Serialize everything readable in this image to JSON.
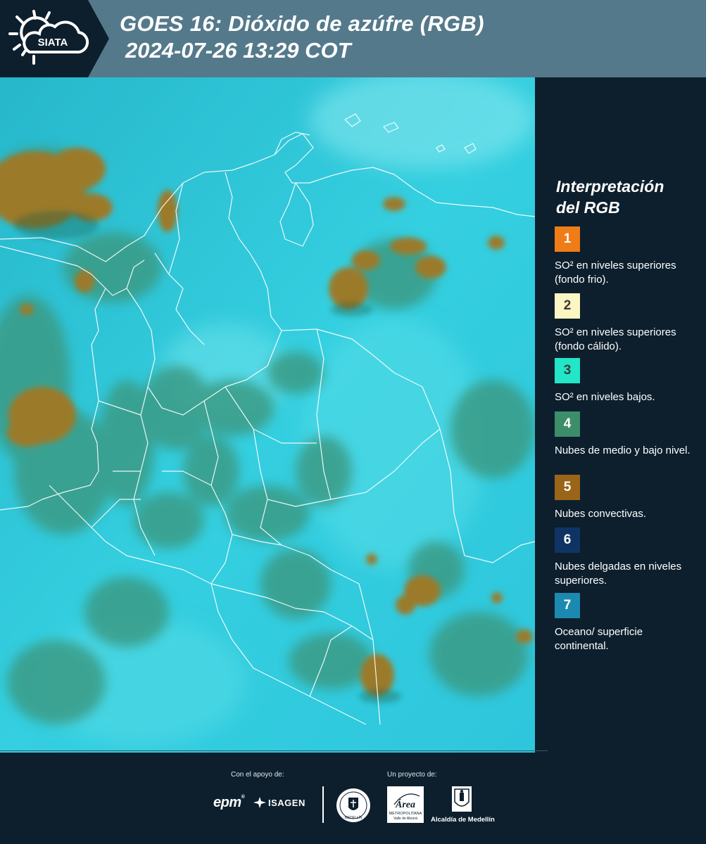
{
  "header": {
    "logo_text": "SIATA",
    "title_line1": "GOES 16: Dióxido de azúfre (RGB)",
    "title_line2": "2024-07-26 13:29 COT"
  },
  "map": {
    "name": "satellite-rgb-map",
    "colors": {
      "ocean": "#33d2e4",
      "land": "#2bbacc",
      "low_clouds": "#3c9a86",
      "convective": "#9c7a2c",
      "borders": "#ffffff"
    }
  },
  "legend": {
    "title_line1": "Interpretación",
    "title_line2": "del RGB",
    "items": [
      {
        "number": "1",
        "color": "#f07c17",
        "text_color": "#ffffff",
        "label": "SO² en niveles superiores (fondo frio)."
      },
      {
        "number": "2",
        "color": "#fbf6c2",
        "text_color": "#3a3a3a",
        "label": "SO² en niveles superiores (fondo cálido)."
      },
      {
        "number": "3",
        "color": "#22e6c8",
        "text_color": "#3a3a3a",
        "label": "SO² en niveles bajos."
      },
      {
        "number": "4",
        "color": "#3c8e6a",
        "text_color": "#ffffff",
        "label": "Nubes de medio y bajo nivel."
      },
      {
        "number": "5",
        "color": "#9a6518",
        "text_color": "#ffffff",
        "label": "Nubes convectivas."
      },
      {
        "number": "6",
        "color": "#0f3463",
        "text_color": "#ffffff",
        "label": "Nubes delgadas en niveles superiores."
      },
      {
        "number": "7",
        "color": "#1c8ab0",
        "text_color": "#ffffff",
        "label": "Oceano/ superficie continental."
      }
    ]
  },
  "footer": {
    "support_label": "Con el apoyo de:",
    "project_label": "Un proyecto de:",
    "epm": "epm",
    "isagen": "ISAGEN",
    "area_metro": "Área",
    "area_metro_sub": "METROPOLITANA",
    "area_metro_sub2": "Valle de Aburrá",
    "alcaldia": "Alcaldía de Medellín",
    "medellin_seal": "MEDELLÍN"
  }
}
